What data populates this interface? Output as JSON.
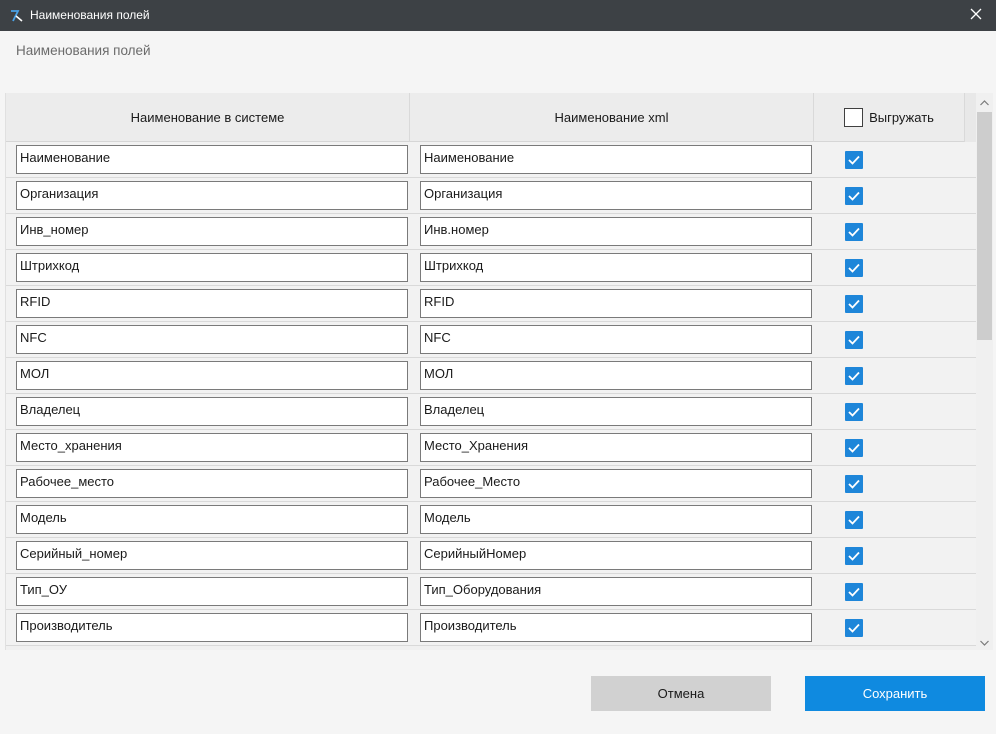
{
  "window": {
    "title": "Наименования полей",
    "app_icon": "app-logo-icon",
    "close_icon": "close-icon"
  },
  "subtitle": "Наименования полей",
  "table": {
    "columns": {
      "system_name": "Наименование в системе",
      "xml_name": "Наименование xml",
      "export": "Выгружать"
    },
    "export_all_checked": false,
    "rows": [
      {
        "system": "Наименование",
        "xml": "Наименование",
        "export": true
      },
      {
        "system": "Организация",
        "xml": "Организация",
        "export": true
      },
      {
        "system": "Инв_номер",
        "xml": "Инв.номер",
        "export": true
      },
      {
        "system": "Штрихкод",
        "xml": "Штрихкод",
        "export": true
      },
      {
        "system": "RFID",
        "xml": "RFID",
        "export": true
      },
      {
        "system": "NFC",
        "xml": "NFC",
        "export": true
      },
      {
        "system": "МОЛ",
        "xml": "МОЛ",
        "export": true
      },
      {
        "system": "Владелец",
        "xml": "Владелец",
        "export": true
      },
      {
        "system": "Место_хранения",
        "xml": "Место_Хранения",
        "export": true
      },
      {
        "system": "Рабочее_место",
        "xml": "Рабочее_Место",
        "export": true
      },
      {
        "system": "Модель",
        "xml": "Модель",
        "export": true
      },
      {
        "system": "Серийный_номер",
        "xml": "СерийныйНомер",
        "export": true
      },
      {
        "system": "Тип_ОУ",
        "xml": "Тип_Оборудования",
        "export": true
      },
      {
        "system": "Производитель",
        "xml": "Производитель",
        "export": true
      }
    ]
  },
  "buttons": {
    "cancel": "Отмена",
    "save": "Сохранить"
  },
  "colors": {
    "titlebar": "#3d4145",
    "accent": "#0f8ae0",
    "checkbox": "#1e86d9"
  }
}
